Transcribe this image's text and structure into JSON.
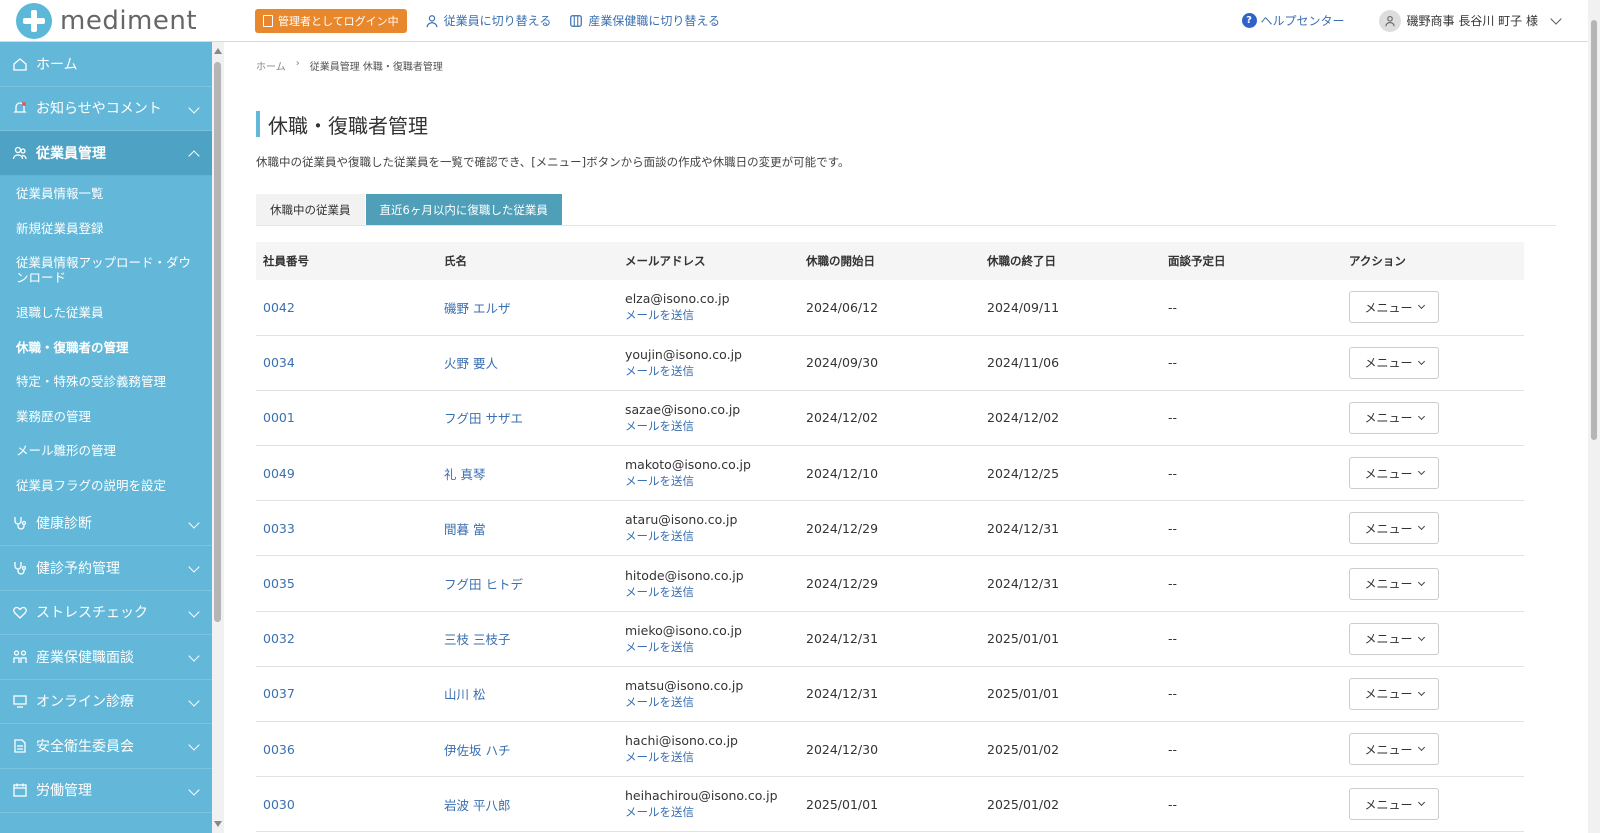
{
  "header": {
    "logo_text": "mediment",
    "admin_badge": "管理者としてログイン中",
    "switch_employee": "従業員に切り替える",
    "switch_health_staff": "産業保健職に切り替える",
    "help_center": "ヘルプセンター",
    "user_name": "磯野商事 長谷川 町子 様"
  },
  "sidebar": {
    "items": [
      {
        "label": "ホーム",
        "icon": "home-icon"
      },
      {
        "label": "お知らせやコメント",
        "icon": "bell-icon"
      },
      {
        "label": "従業員管理",
        "icon": "people-icon"
      },
      {
        "label": "健康診断",
        "icon": "stethoscope-icon"
      },
      {
        "label": "健診予約管理",
        "icon": "stethoscope-icon"
      },
      {
        "label": "ストレスチェック",
        "icon": "heart-icon"
      },
      {
        "label": "産業保健職面談",
        "icon": "meeting-icon"
      },
      {
        "label": "オンライン診療",
        "icon": "monitor-icon"
      },
      {
        "label": "安全衛生委員会",
        "icon": "document-icon"
      },
      {
        "label": "労働管理",
        "icon": "calendar-icon"
      }
    ],
    "sub_items": [
      "従業員情報一覧",
      "新規従業員登録",
      "従業員情報アップロード・ダウンロード",
      "退職した従業員",
      "休職・復職者の管理",
      "特定・特殊の受診義務管理",
      "業務歴の管理",
      "メール雛形の管理",
      "従業員フラグの説明を設定"
    ]
  },
  "breadcrumb": {
    "home": "ホーム",
    "current": "従業員管理 休職・復職者管理"
  },
  "page": {
    "title": "休職・復職者管理",
    "description": "休職中の従業員や復職した従業員を一覧で確認でき、[メニュー]ボタンから面談の作成や休職日の変更が可能です。"
  },
  "tabs": [
    {
      "label": "休職中の従業員",
      "active": false
    },
    {
      "label": "直近6ヶ月以内に復職した従業員",
      "active": true
    }
  ],
  "table": {
    "columns": [
      "社員番号",
      "氏名",
      "メールアドレス",
      "休職の開始日",
      "休職の終了日",
      "面談予定日",
      "アクション"
    ],
    "send_mail_label": "メールを送信",
    "menu_label": "メニュー",
    "rows": [
      {
        "id": "0042",
        "name": "磯野 エルザ",
        "email": "elza@isono.co.jp",
        "start": "2024/06/12",
        "end": "2024/09/11",
        "interview": "--"
      },
      {
        "id": "0034",
        "name": "火野 要人",
        "email": "youjin@isono.co.jp",
        "start": "2024/09/30",
        "end": "2024/11/06",
        "interview": "--"
      },
      {
        "id": "0001",
        "name": "フグ田 サザエ",
        "email": "sazae@isono.co.jp",
        "start": "2024/12/02",
        "end": "2024/12/02",
        "interview": "--"
      },
      {
        "id": "0049",
        "name": "礼 真琴",
        "email": "makoto@isono.co.jp",
        "start": "2024/12/10",
        "end": "2024/12/25",
        "interview": "--"
      },
      {
        "id": "0033",
        "name": "間暮 當",
        "email": "ataru@isono.co.jp",
        "start": "2024/12/29",
        "end": "2024/12/31",
        "interview": "--"
      },
      {
        "id": "0035",
        "name": "フグ田 ヒトデ",
        "email": "hitode@isono.co.jp",
        "start": "2024/12/29",
        "end": "2024/12/31",
        "interview": "--"
      },
      {
        "id": "0032",
        "name": "三枝 三枝子",
        "email": "mieko@isono.co.jp",
        "start": "2024/12/31",
        "end": "2025/01/01",
        "interview": "--"
      },
      {
        "id": "0037",
        "name": "山川 松",
        "email": "matsu@isono.co.jp",
        "start": "2024/12/31",
        "end": "2025/01/01",
        "interview": "--"
      },
      {
        "id": "0036",
        "name": "伊佐坂 ハチ",
        "email": "hachi@isono.co.jp",
        "start": "2024/12/30",
        "end": "2025/01/02",
        "interview": "--"
      },
      {
        "id": "0030",
        "name": "岩波 平八郎",
        "email": "heihachirou@isono.co.jp",
        "start": "2025/01/01",
        "end": "2025/01/02",
        "interview": "--"
      }
    ]
  },
  "colors": {
    "sidebar": "#63b8d9",
    "sidebar_active": "#4ea3c4",
    "tab_active": "#4f9fb9",
    "admin_badge": "#e9872d",
    "link": "#3a6fb0"
  }
}
